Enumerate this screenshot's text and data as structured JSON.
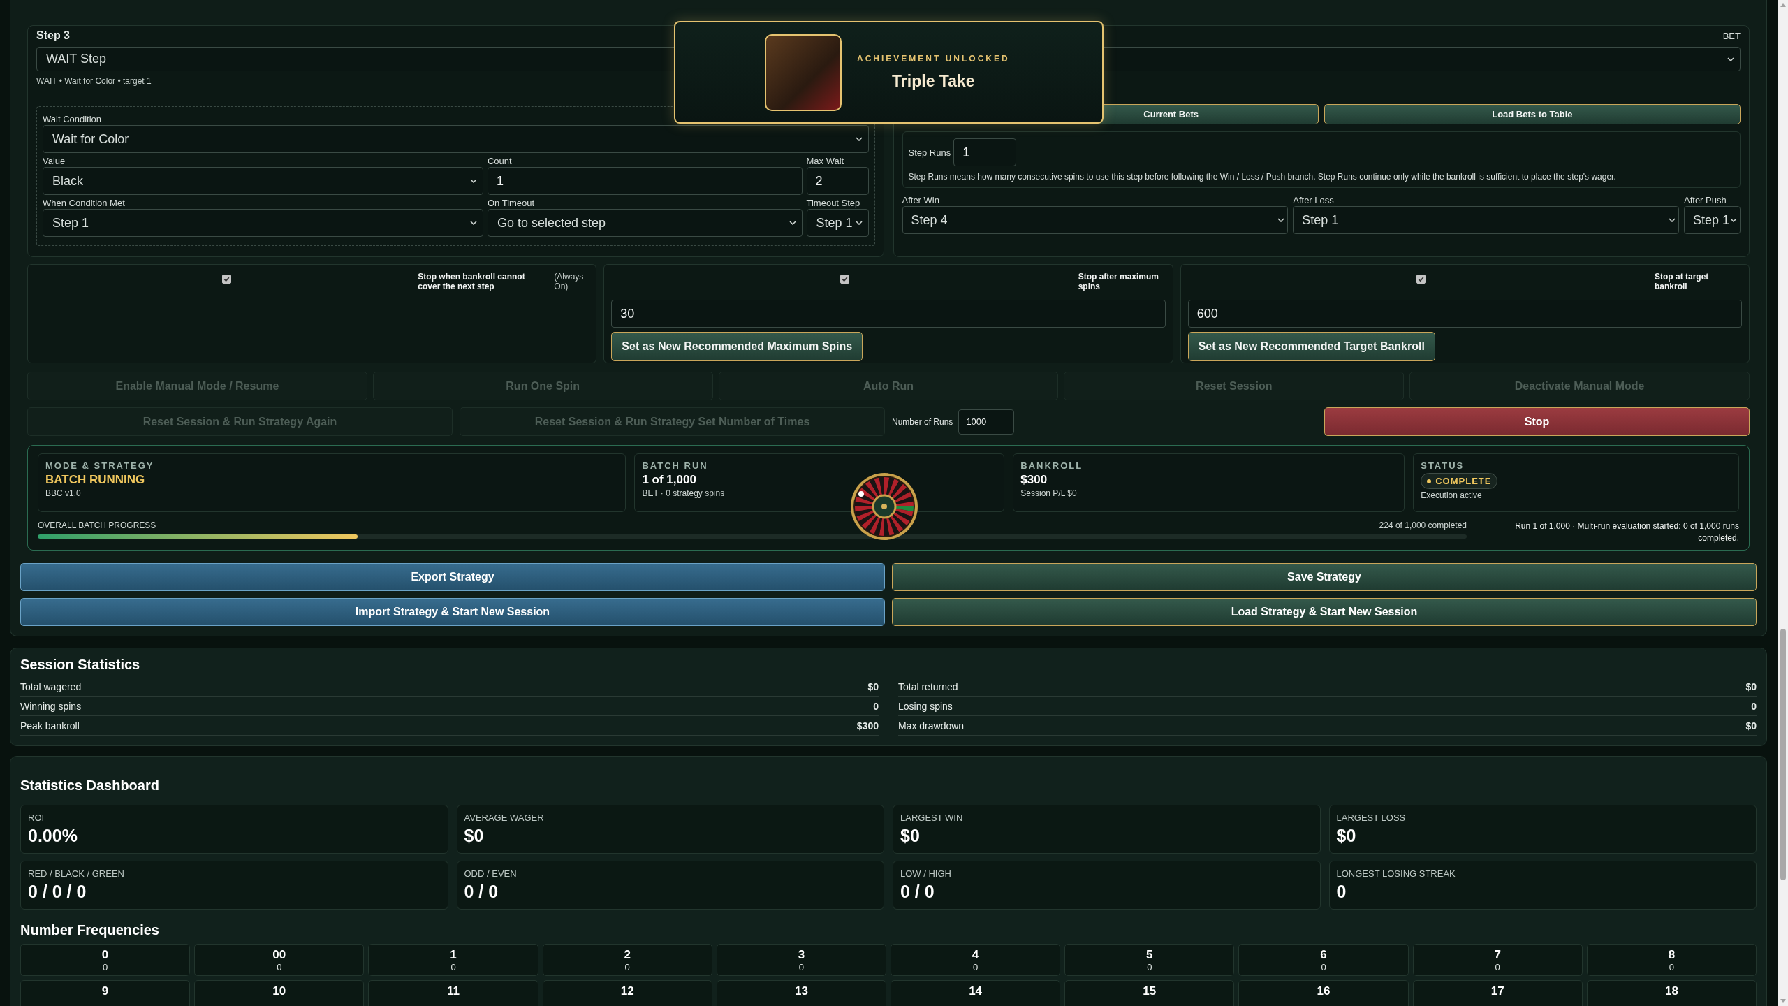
{
  "toast": {
    "label": "ACHIEVEMENT UNLOCKED",
    "title": "Triple Take"
  },
  "steps": [
    {
      "kind": "wait",
      "title": "Step 3",
      "step_type": "WAIT Step",
      "summary": "WAIT • Wait for Color • target 1",
      "rows": [
        [
          {
            "label": "Wait Condition",
            "value": "Wait for Color",
            "kind": "select"
          }
        ],
        [
          {
            "label": "Value",
            "value": "Black",
            "kind": "select"
          },
          {
            "label": "Count",
            "value": "1",
            "kind": "input"
          },
          {
            "label": "Max Wait",
            "value": "2",
            "kind": "input"
          }
        ],
        [
          {
            "label": "When Condition Met",
            "value": "Step 1",
            "kind": "select"
          },
          {
            "label": "On Timeout",
            "value": "Go to selected step",
            "kind": "select"
          },
          {
            "label": "Timeout Step",
            "value": "Step 1",
            "kind": "select"
          }
        ]
      ]
    },
    {
      "kind": "bet",
      "type_label": "BET",
      "buttons": [
        "Current Bets",
        "Load Bets to Table"
      ],
      "step_runs": {
        "label": "Step Runs",
        "value": "1"
      },
      "step_runs_note": "Step Runs means how many consecutive spins to use this step before following the Win / Loss / Push branch. Step Runs continue only while the bankroll is sufficient to place the step's wager.",
      "branches": [
        {
          "label": "After Win",
          "value": "Step 4"
        },
        {
          "label": "After Loss",
          "value": "Step 1"
        },
        {
          "label": "After Push",
          "value": "Step 1"
        }
      ]
    }
  ],
  "stop_conditions": [
    {
      "kind": "always",
      "checked": true,
      "label": "Stop when bankroll cannot cover the next step",
      "note": "(Always On)"
    },
    {
      "kind": "limit",
      "checked": true,
      "label": "Stop after maximum spins",
      "value": "30",
      "button": "Set as New Recommended Maximum Spins"
    },
    {
      "kind": "limit",
      "checked": true,
      "label": "Stop at target bankroll",
      "value": "600",
      "button": "Set as New Recommended Target Bankroll"
    }
  ],
  "controls": [
    {
      "label": "Enable Manual Mode / Resume",
      "disabled": true
    },
    {
      "label": "Run One Spin",
      "disabled": true
    },
    {
      "label": "Auto Run",
      "disabled": true
    },
    {
      "label": "Reset Session",
      "disabled": true
    },
    {
      "label": "Deactivate Manual Mode",
      "disabled": true
    }
  ],
  "run_controls": {
    "buttons": [
      {
        "label": "Reset Session & Run Strategy Again",
        "disabled": true
      },
      {
        "label": "Reset Session & Run Strategy Set Number of Times",
        "disabled": true
      }
    ],
    "number_of_runs": {
      "label": "Number of Runs",
      "value": "1000"
    },
    "stop_button": "Stop"
  },
  "status": {
    "cards": [
      {
        "kind": "mode",
        "heading": "MODE & STRATEGY",
        "value": "BATCH RUNNING",
        "detail": "BBC v1.0"
      },
      {
        "kind": "plain",
        "heading": "BATCH RUN",
        "value": "1 of 1,000",
        "detail": "BET · 0 strategy spins"
      },
      {
        "kind": "plain",
        "heading": "BANKROLL",
        "value": "$300",
        "detail": "Session P/L $0"
      },
      {
        "kind": "badge",
        "heading": "STATUS",
        "value": "COMPLETE",
        "detail": "Execution active"
      }
    ],
    "progress": {
      "label": "OVERALL BATCH PROGRESS",
      "level": 0.224,
      "count": "224 of 1,000 completed"
    },
    "note": "Run 1 of 1,000 · Multi-run evaluation started: 0 of 1,000 runs completed."
  },
  "actions": [
    {
      "label": "Export Strategy",
      "kind": "info"
    },
    {
      "label": "Save Strategy",
      "kind": "success"
    },
    {
      "label": "Import Strategy & Start New Session",
      "kind": "info"
    },
    {
      "label": "Load Strategy & Start New Session",
      "kind": "success"
    }
  ],
  "session_statistics": {
    "title": "Session Statistics",
    "rows": [
      {
        "label": "Total wagered",
        "value": "$0"
      },
      {
        "label": "Total returned",
        "value": "$0"
      },
      {
        "label": "Winning spins",
        "value": "0"
      },
      {
        "label": "Losing spins",
        "value": "0"
      },
      {
        "label": "Peak bankroll",
        "value": "$300"
      },
      {
        "label": "Max drawdown",
        "value": "$0"
      }
    ]
  },
  "dashboard": {
    "title": "Statistics Dashboard",
    "cards": [
      {
        "label": "ROI",
        "value": "0.00%"
      },
      {
        "label": "AVERAGE WAGER",
        "value": "$0"
      },
      {
        "label": "LARGEST WIN",
        "value": "$0"
      },
      {
        "label": "LARGEST LOSS",
        "value": "$0"
      },
      {
        "label": "RED / BLACK / GREEN",
        "value": "0 / 0 / 0"
      },
      {
        "label": "ODD / EVEN",
        "value": "0 / 0"
      },
      {
        "label": "LOW / HIGH",
        "value": "0 / 0"
      },
      {
        "label": "LONGEST LOSING STREAK",
        "value": "0"
      }
    ],
    "frequencies_title": "Number Frequencies",
    "frequencies": [
      {
        "number": "0",
        "count": "0"
      },
      {
        "number": "00",
        "count": "0"
      },
      {
        "number": "1",
        "count": "0"
      },
      {
        "number": "2",
        "count": "0"
      },
      {
        "number": "3",
        "count": "0"
      },
      {
        "number": "4",
        "count": "0"
      },
      {
        "number": "5",
        "count": "0"
      },
      {
        "number": "6",
        "count": "0"
      },
      {
        "number": "7",
        "count": "0"
      },
      {
        "number": "8",
        "count": "0"
      },
      {
        "number": "9"
      },
      {
        "number": "10"
      },
      {
        "number": "11"
      },
      {
        "number": "12"
      },
      {
        "number": "13"
      },
      {
        "number": "14"
      },
      {
        "number": "15"
      },
      {
        "number": "16"
      },
      {
        "number": "17"
      },
      {
        "number": "18"
      }
    ]
  }
}
